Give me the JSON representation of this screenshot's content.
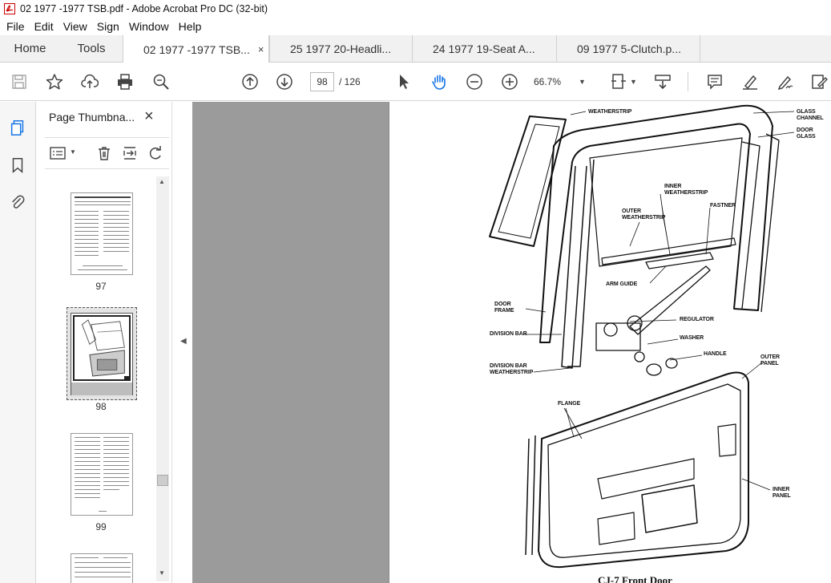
{
  "window": {
    "title": "02 1977 -1977 TSB.pdf - Adobe Acrobat Pro DC (32-bit)"
  },
  "menu": [
    "File",
    "Edit",
    "View",
    "Sign",
    "Window",
    "Help"
  ],
  "nav_tabs": {
    "home": "Home",
    "tools": "Tools"
  },
  "doc_tabs": [
    {
      "label": "02 1977 -1977 TSB...",
      "active": true,
      "close": "×"
    },
    {
      "label": "25 1977 20-Headli...",
      "active": false
    },
    {
      "label": "24 1977 19-Seat A...",
      "active": false
    },
    {
      "label": "09 1977 5-Clutch.p...",
      "active": false
    }
  ],
  "toolbar": {
    "page_current": "98",
    "page_total": "/ 126",
    "zoom": "66.7%",
    "icons": [
      "save-icon",
      "bookmark-star-icon",
      "upload-icon",
      "print-icon",
      "search-zoom-icon",
      "page-up-icon",
      "page-down-icon",
      "select-pointer-icon",
      "hand-tool-icon",
      "zoom-out-icon",
      "zoom-in-icon",
      "fit-page-icon",
      "scroll-mode-icon",
      "comment-icon",
      "highlight-icon",
      "sign-icon",
      "edit-pdf-icon"
    ]
  },
  "left_rail": {
    "icons": [
      "page-thumbnails-icon",
      "bookmarks-icon",
      "attachments-icon"
    ]
  },
  "thumbnail_panel": {
    "title": "Page Thumbna...",
    "close": "×",
    "thumbnails": [
      {
        "page": "97"
      },
      {
        "page": "98",
        "selected": true
      },
      {
        "page": "99"
      }
    ]
  },
  "document": {
    "callouts": {
      "weatherstrip": "WEATHERSTRIP",
      "glass_channel": [
        "GLASS",
        "CHANNEL"
      ],
      "door_glass": [
        "DOOR",
        "GLASS"
      ],
      "inner_weatherstrip": [
        "INNER",
        "WEATHERSTRIP"
      ],
      "outer_weatherstrip": [
        "OUTER",
        "WEATHERSTRIP"
      ],
      "fastner": "FASTNER",
      "arm_guide": "ARM GUIDE",
      "door_frame": [
        "DOOR",
        "FRAME"
      ],
      "regulator": "REGULATOR",
      "washer": "WASHER",
      "division_bar": "DIVISION BAR",
      "handle": "HANDLE",
      "outer_panel": [
        "OUTER",
        "PANEL"
      ],
      "division_bar_weatherstrip": [
        "DIVISION BAR",
        "WEATHERSTRIP"
      ],
      "flange": "FLANGE",
      "inner_panel": [
        "INNER",
        "PANEL"
      ]
    },
    "caption": "CJ-7 Front Door"
  }
}
